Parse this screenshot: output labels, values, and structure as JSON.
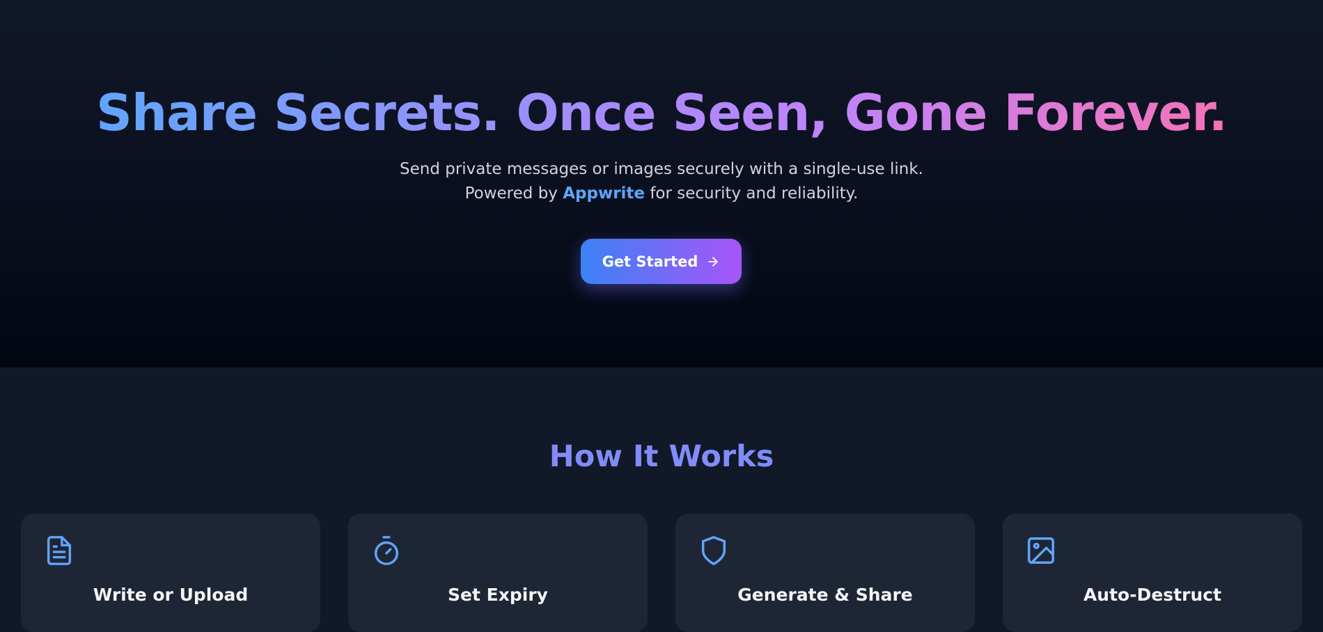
{
  "hero": {
    "title": "Share Secrets. Once Seen, Gone Forever.",
    "subtitle_before": "Send private messages or images securely with a single-use link. Powered by",
    "subtitle_brand": "Appwrite",
    "subtitle_after": "for security and reliability.",
    "cta_label": "Get Started",
    "cta_icon": "arrow-right-icon"
  },
  "how_it_works": {
    "title": "How It Works",
    "steps": [
      {
        "title": "Write or Upload",
        "icon": "document-icon"
      },
      {
        "title": "Set Expiry",
        "icon": "timer-icon"
      },
      {
        "title": "Generate & Share",
        "icon": "shield-icon"
      },
      {
        "title": "Auto-Destruct",
        "icon": "image-icon"
      }
    ]
  },
  "colors": {
    "background": "#111827",
    "card": "#1e2635",
    "accent_blue": "#60a5fa",
    "accent_purple": "#a855f7",
    "accent_pink": "#f472b6",
    "section_title": "#818cf8"
  }
}
